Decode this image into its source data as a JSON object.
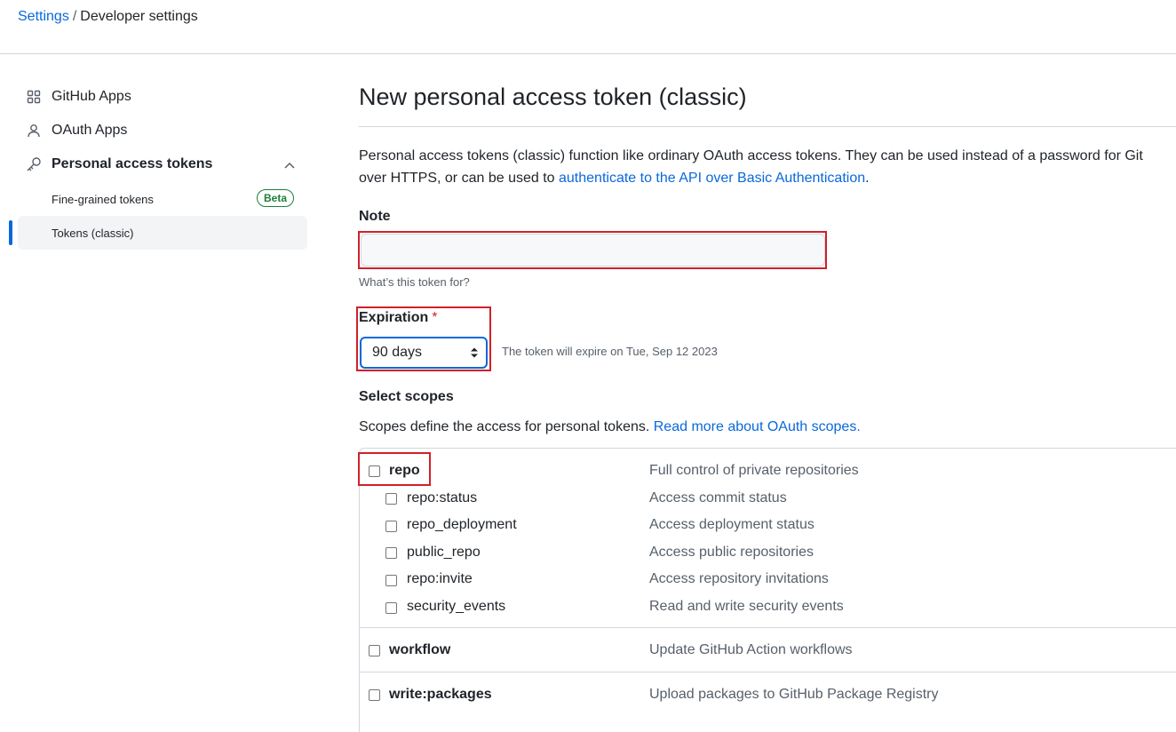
{
  "breadcrumb": {
    "root": "Settings",
    "separator": "/",
    "current": "Developer settings"
  },
  "sidebar": {
    "items": [
      {
        "label": "GitHub Apps",
        "icon": "apps-grid-icon"
      },
      {
        "label": "OAuth Apps",
        "icon": "person-icon"
      },
      {
        "label": "Personal access tokens",
        "icon": "key-icon"
      }
    ],
    "sub_items": [
      {
        "label": "Fine-grained tokens",
        "badge": "Beta"
      },
      {
        "label": "Tokens (classic)"
      }
    ]
  },
  "main": {
    "title": "New personal access token (classic)",
    "intro_text": "Personal access tokens (classic) function like ordinary OAuth access tokens. They can be used instead of a password for Git over HTTPS, or can be used to ",
    "intro_link": "authenticate to the API over Basic Authentication",
    "intro_end": ".",
    "note": {
      "label": "Note",
      "value": "",
      "hint": "What’s this token for?"
    },
    "expiration": {
      "label": "Expiration",
      "required_mark": "*",
      "selected": "90 days",
      "hint": "The token will expire on Tue, Sep 12 2023"
    },
    "scopes": {
      "heading": "Select scopes",
      "description": "Scopes define the access for personal tokens. ",
      "link": "Read more about OAuth scopes.",
      "rows": [
        {
          "name": "repo",
          "desc": "Full control of private repositories",
          "parent": true
        },
        {
          "name": "repo:status",
          "desc": "Access commit status",
          "parent": false
        },
        {
          "name": "repo_deployment",
          "desc": "Access deployment status",
          "parent": false
        },
        {
          "name": "public_repo",
          "desc": "Access public repositories",
          "parent": false
        },
        {
          "name": "repo:invite",
          "desc": "Access repository invitations",
          "parent": false
        },
        {
          "name": "security_events",
          "desc": "Read and write security events",
          "parent": false
        },
        {
          "name": "workflow",
          "desc": "Update GitHub Action workflows",
          "parent": true
        },
        {
          "name": "write:packages",
          "desc": "Upload packages to GitHub Package Registry",
          "parent": true
        }
      ]
    }
  },
  "colors": {
    "link": "#0969da",
    "highlight": "#d0202a",
    "beta": "#1a7f37"
  }
}
